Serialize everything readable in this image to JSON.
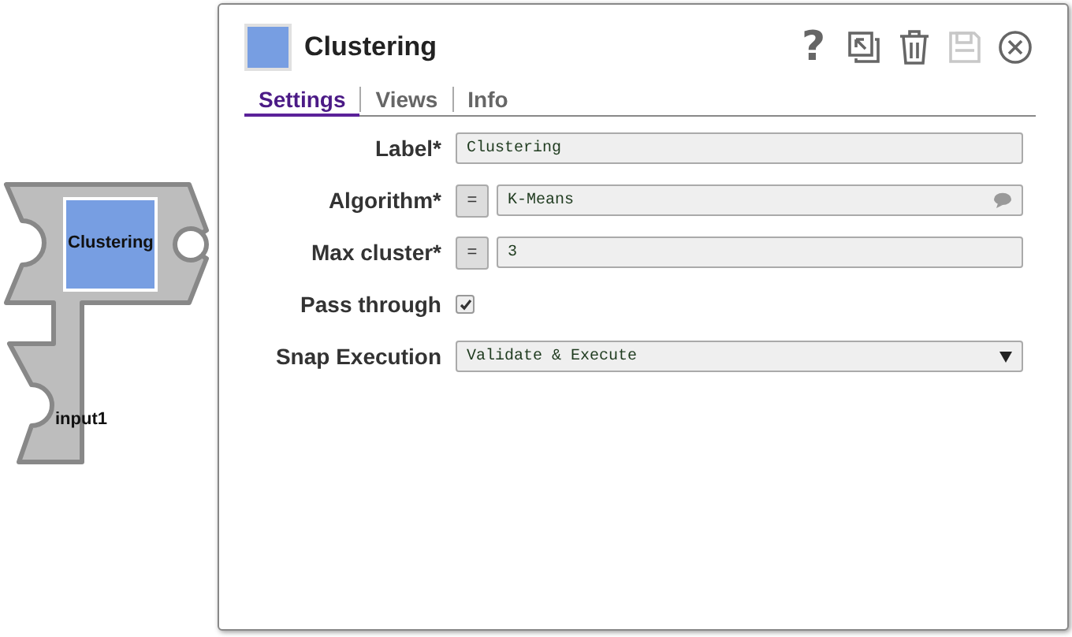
{
  "snap": {
    "label": "Clustering",
    "input_label": "input1"
  },
  "dialog": {
    "title": "Clustering",
    "toolbar": [
      {
        "kind": "help",
        "glyph": "?",
        "disabled": false
      },
      {
        "kind": "export",
        "disabled": false
      },
      {
        "kind": "delete",
        "disabled": false
      },
      {
        "kind": "save",
        "disabled": true
      },
      {
        "kind": "close",
        "disabled": false
      }
    ],
    "tabs": [
      {
        "label": "Settings",
        "selected": true
      },
      {
        "label": "Views",
        "selected": false
      },
      {
        "label": "Info",
        "selected": false
      }
    ],
    "fields": [
      {
        "label": "Label*",
        "kind": "text",
        "value": "Clustering"
      },
      {
        "label": "Algorithm*",
        "kind": "expression",
        "toggle": "=",
        "value": "K-Means",
        "suggestions": true
      },
      {
        "label": "Max cluster*",
        "kind": "expression",
        "toggle": "=",
        "value": "3",
        "suggestions": false
      },
      {
        "label": "Pass through",
        "kind": "checkbox",
        "checked": true
      },
      {
        "label": "Snap Execution",
        "kind": "select",
        "value": "Validate & Execute"
      }
    ]
  }
}
